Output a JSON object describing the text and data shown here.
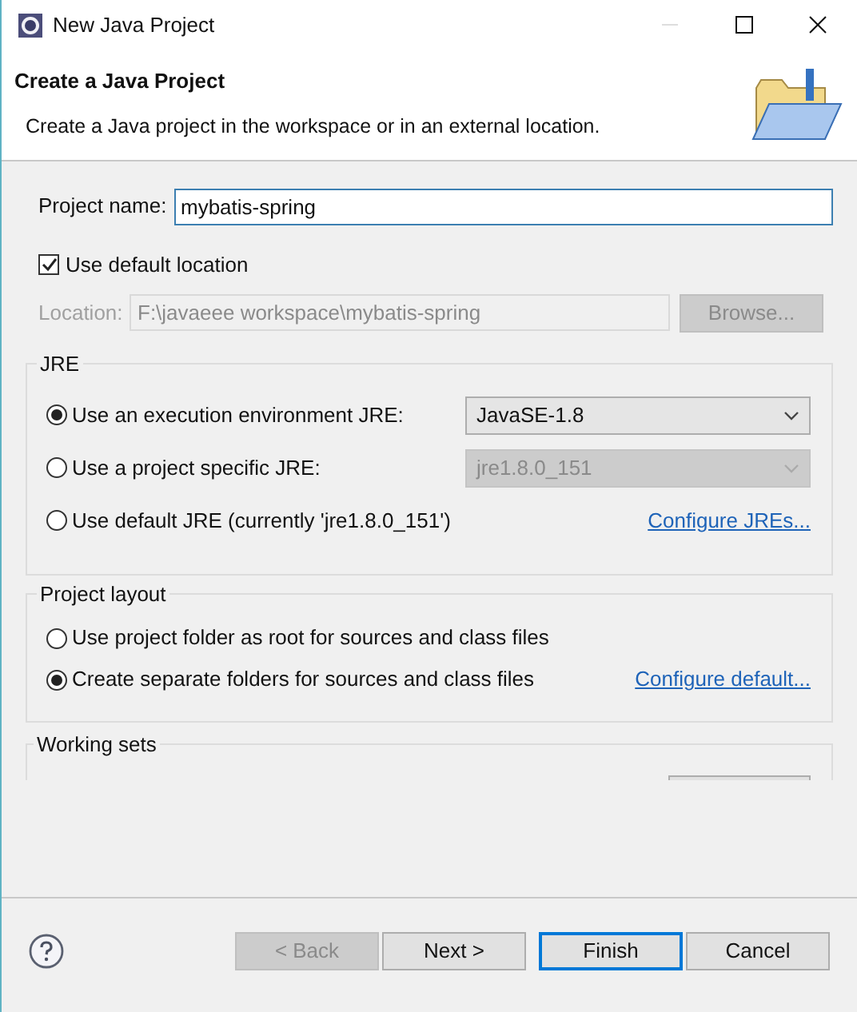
{
  "window": {
    "title": "New Java Project"
  },
  "header": {
    "title": "Create a Java Project",
    "description": "Create a Java project in the workspace or in an external location."
  },
  "project_name": {
    "label": "Project name:",
    "value": "mybatis-spring"
  },
  "use_default_location": {
    "label": "Use default location",
    "checked": true
  },
  "location": {
    "label": "Location:",
    "value": "F:\\javaeee workspace\\mybatis-spring",
    "disabled": true,
    "browse": "Browse..."
  },
  "jre": {
    "title": "JRE",
    "options": [
      {
        "label": "Use an execution environment JRE:",
        "selected": true,
        "kind": "dropdown",
        "value": "JavaSE-1.8",
        "disabled": false
      },
      {
        "label": "Use a project specific JRE:",
        "selected": false,
        "kind": "dropdown",
        "value": "jre1.8.0_151",
        "disabled": true
      },
      {
        "label": "Use default JRE (currently 'jre1.8.0_151')",
        "selected": false,
        "kind": "link",
        "link": "Configure JREs..."
      }
    ]
  },
  "project_layout": {
    "title": "Project layout",
    "options": [
      {
        "label": "Use project folder as root for sources and class files",
        "selected": false
      },
      {
        "label": "Create separate folders for sources and class files",
        "selected": true,
        "link": "Configure default..."
      }
    ]
  },
  "working_sets": {
    "title": "Working sets"
  },
  "buttons": [
    {
      "label": "< Back",
      "disabled": true,
      "default": false
    },
    {
      "label": "Next >",
      "disabled": false,
      "default": false
    },
    {
      "label": "Finish",
      "disabled": false,
      "default": true
    },
    {
      "label": "Cancel",
      "disabled": false,
      "default": false
    }
  ]
}
